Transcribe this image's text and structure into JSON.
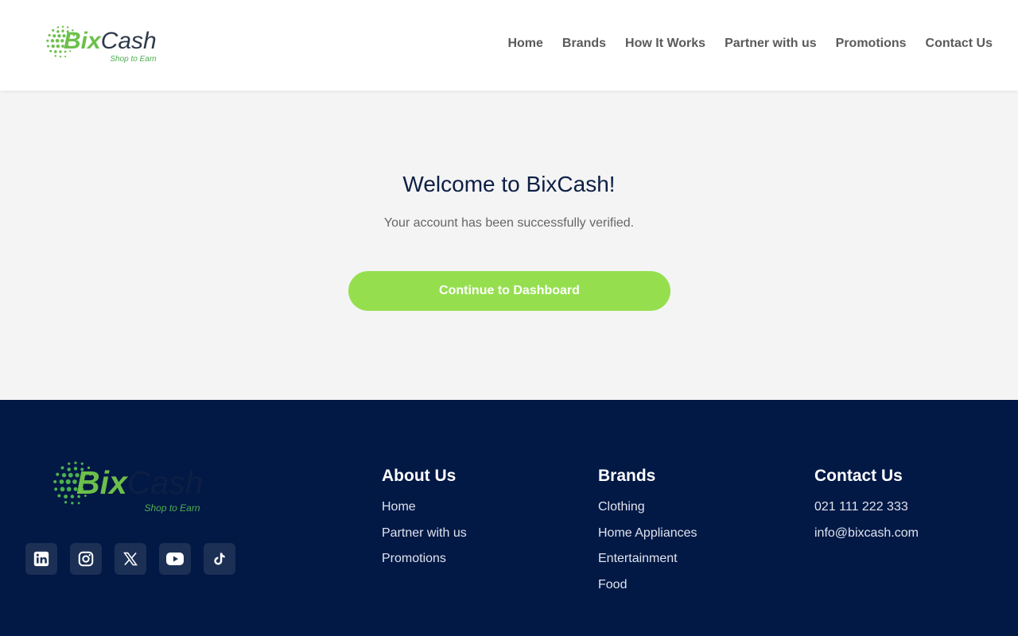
{
  "header": {
    "logo": {
      "brand_primary": "Bix",
      "brand_secondary": "Cash",
      "tagline": "Shop to Earn"
    },
    "nav": [
      {
        "label": "Home"
      },
      {
        "label": "Brands"
      },
      {
        "label": "How It Works"
      },
      {
        "label": "Partner with us"
      },
      {
        "label": "Promotions"
      },
      {
        "label": "Contact Us"
      }
    ]
  },
  "main": {
    "title": "Welcome to BixCash!",
    "subtitle": "Your account has been successfully verified.",
    "cta_label": "Continue to Dashboard"
  },
  "footer": {
    "logo": {
      "brand_primary": "Bix",
      "brand_secondary": "Cash",
      "tagline": "Shop to Earn"
    },
    "social_icons": [
      "linkedin-icon",
      "instagram-icon",
      "x-icon",
      "youtube-icon",
      "tiktok-icon"
    ],
    "about": {
      "heading": "About Us",
      "links": [
        "Home",
        "Partner with us",
        "Promotions"
      ]
    },
    "brands": {
      "heading": "Brands",
      "links": [
        "Clothing",
        "Home Appliances",
        "Entertainment",
        "Food"
      ]
    },
    "contact": {
      "heading": "Contact Us",
      "phone": "021 111 222 333",
      "email": "info@bixcash.com"
    }
  },
  "colors": {
    "accent_green": "#95df4f",
    "logo_green": "#6cc04a",
    "navy": "#021845",
    "title_navy": "#0d1f44"
  }
}
